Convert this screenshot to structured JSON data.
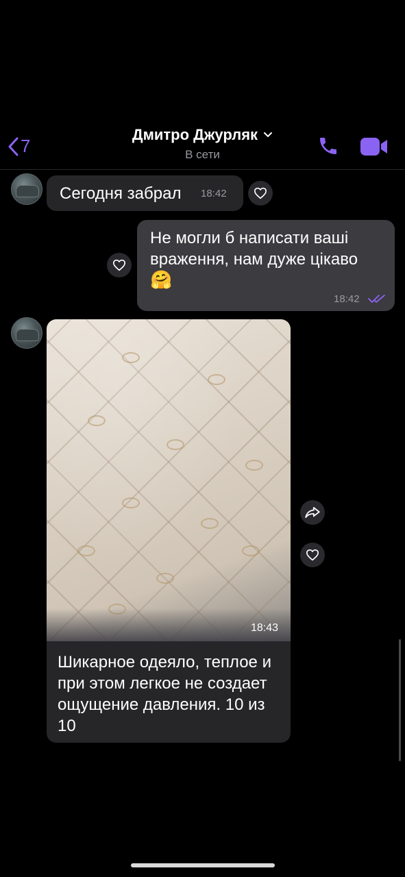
{
  "header": {
    "back_count": "7",
    "contact_name": "Дмитро Джурляк",
    "status": "В сети",
    "accent": "#8b63f2"
  },
  "messages": [
    {
      "direction": "incoming",
      "text": "Сегодня забрал",
      "time": "18:42"
    },
    {
      "direction": "outgoing",
      "text": "Не могли б написати ваші враження, нам дуже цікаво",
      "emoji": "🤗",
      "time": "18:42",
      "read": true
    },
    {
      "direction": "incoming",
      "type": "photo",
      "photo_time": "18:43",
      "text": "Шикарное одеяло, теплое и при этом легкое не создает ощущение давления. 10 из 10"
    }
  ],
  "icons": [
    "back-chevron-icon",
    "chevron-down-icon",
    "phone-icon",
    "video-camera-icon",
    "heart-icon",
    "share-icon",
    "read-checkmarks-icon"
  ]
}
